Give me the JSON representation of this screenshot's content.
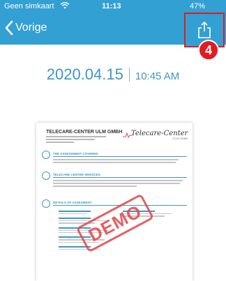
{
  "status_bar": {
    "carrier": "Geen simkaart",
    "time": "11:13",
    "battery": "47%"
  },
  "nav": {
    "back_label": "Vorige"
  },
  "annotation": {
    "step_number": "4"
  },
  "header": {
    "date": "2020.04.15",
    "time": "10:45 AM"
  },
  "document": {
    "company": "TELECARE-CENTER ULM GMBH",
    "logo_text": "Telecare-Center",
    "logo_subtext": "ULM GMBH",
    "sections": [
      {
        "label": "THE ASSESSMENT COVERED"
      },
      {
        "label": "TELECARE CENTER SERVICES"
      },
      {
        "label": "DETAILS OF ASSESMENT"
      }
    ],
    "stamp": "DEMO"
  },
  "colors": {
    "nav_bar": "#33a0d3",
    "accent_text": "#3f97c4",
    "highlight": "#e11b23",
    "stamp": "#e0454b"
  }
}
